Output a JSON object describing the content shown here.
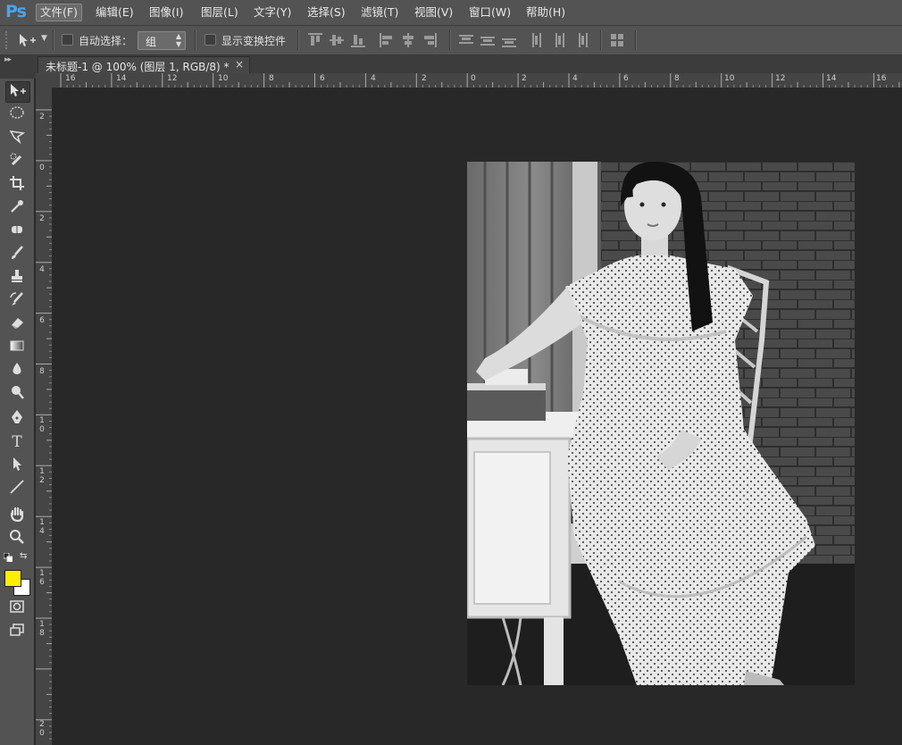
{
  "app": {
    "logo": "Ps"
  },
  "menu": {
    "items": [
      "文件(F)",
      "编辑(E)",
      "图像(I)",
      "图层(L)",
      "文字(Y)",
      "选择(S)",
      "滤镜(T)",
      "视图(V)",
      "窗口(W)",
      "帮助(H)"
    ]
  },
  "options": {
    "auto_select_label": "自动选择：",
    "auto_select_value": "组",
    "show_transform_label": "显示变换控件"
  },
  "document": {
    "tab_title": "未标题-1 @ 100% (图层 1, RGB/8) *",
    "close": "×"
  },
  "ruler": {
    "top_labels": [
      "16",
      "14",
      "12",
      "10",
      "8",
      "6",
      "4",
      "2",
      "0",
      "2",
      "4",
      "6",
      "8",
      "10",
      "12",
      "14",
      "16"
    ],
    "left_labels": [
      "2",
      "0",
      "2",
      "4",
      "6",
      "8",
      "10",
      "12",
      "14",
      "16",
      "18",
      "20"
    ]
  },
  "colors": {
    "foreground": "#ffee00",
    "background": "#ffffff",
    "accent": "#4fa3e8"
  },
  "tools": [
    "move-tool",
    "marquee-tool",
    "lasso-tool",
    "quick-selection-tool",
    "crop-tool",
    "eyedropper-tool",
    "healing-brush-tool",
    "brush-tool",
    "clone-stamp-tool",
    "history-brush-tool",
    "eraser-tool",
    "gradient-tool",
    "blur-tool",
    "dodge-tool",
    "pen-tool",
    "type-tool",
    "path-selection-tool",
    "line-tool",
    "hand-tool",
    "zoom-tool"
  ]
}
